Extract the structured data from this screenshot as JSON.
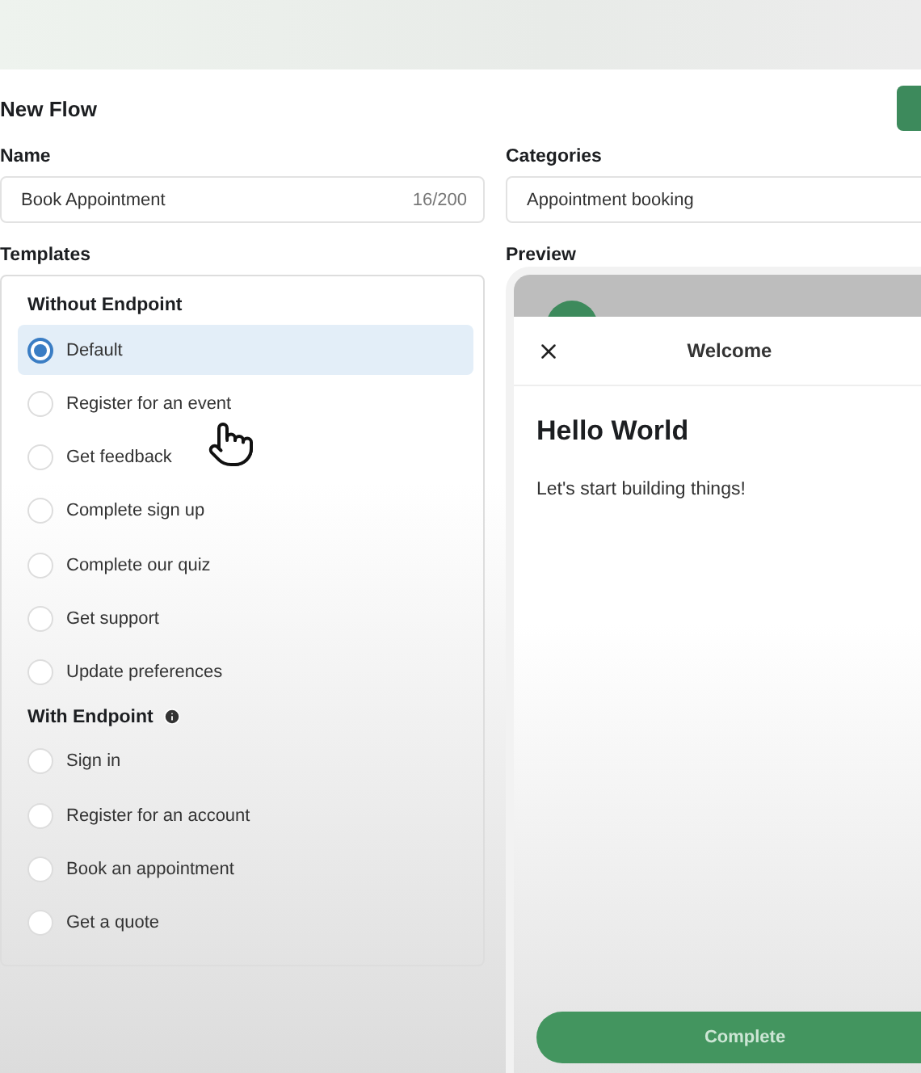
{
  "header": {
    "title": "New Flow"
  },
  "name_field": {
    "label": "Name",
    "value": "Book Appointment",
    "counter": "16/200"
  },
  "categories_field": {
    "label": "Categories",
    "value": "Appointment booking"
  },
  "templates": {
    "label": "Templates",
    "groups": [
      {
        "title": "Without Endpoint",
        "info": false,
        "items": [
          {
            "label": "Default",
            "selected": true
          },
          {
            "label": "Register for an event",
            "selected": false
          },
          {
            "label": "Get feedback",
            "selected": false
          },
          {
            "label": "Complete sign up",
            "selected": false
          },
          {
            "label": "Complete our quiz",
            "selected": false
          },
          {
            "label": "Get support",
            "selected": false
          },
          {
            "label": "Update preferences",
            "selected": false
          }
        ]
      },
      {
        "title": "With Endpoint",
        "info": true,
        "items": [
          {
            "label": "Sign in",
            "selected": false
          },
          {
            "label": "Register for an account",
            "selected": false
          },
          {
            "label": "Book an appointment",
            "selected": false
          },
          {
            "label": "Get a quote",
            "selected": false
          }
        ]
      }
    ]
  },
  "preview": {
    "label": "Preview",
    "screen_title": "Welcome",
    "heading": "Hello World",
    "body": "Let's start building things!",
    "button": "Complete"
  }
}
